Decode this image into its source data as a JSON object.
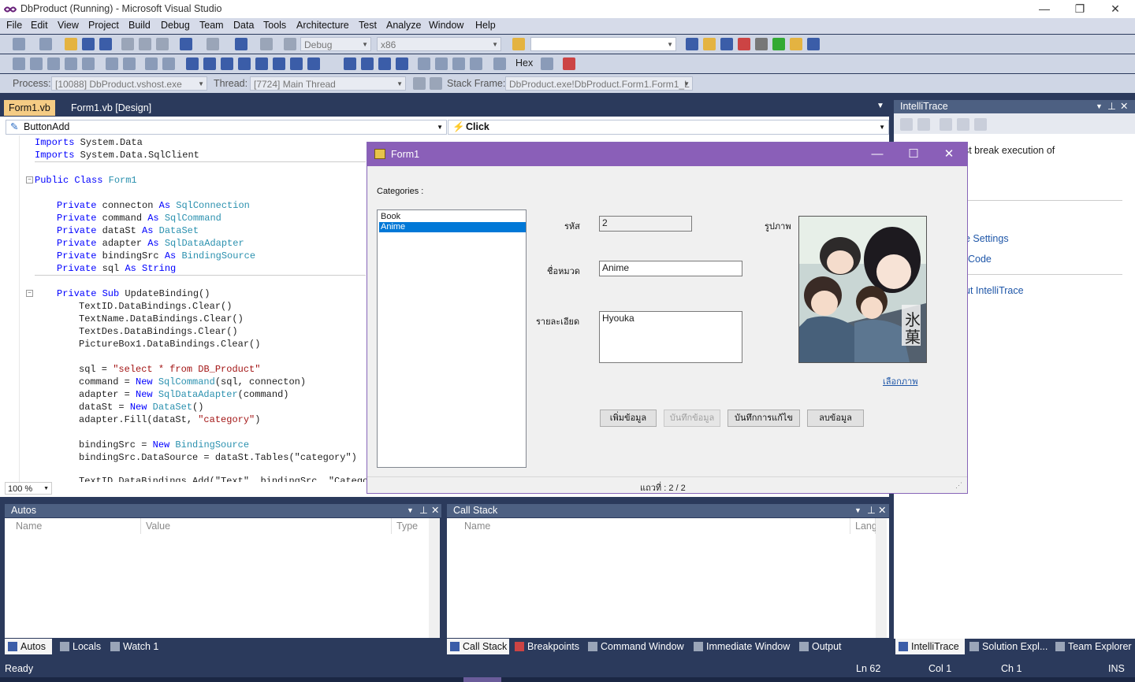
{
  "window": {
    "title": "DbProduct (Running) - Microsoft Visual Studio"
  },
  "menu": [
    "File",
    "Edit",
    "View",
    "Project",
    "Build",
    "Debug",
    "Team",
    "Data",
    "Tools",
    "Architecture",
    "Test",
    "Analyze",
    "Window",
    "Help"
  ],
  "toolbar": {
    "config": "Debug",
    "platform": "x86",
    "hex_label": "Hex",
    "process_label": "Process:",
    "process_value": "[10088] DbProduct.vshost.exe",
    "thread_label": "Thread:",
    "thread_value": "[7724] Main Thread",
    "stackframe_label": "Stack Frame:",
    "stackframe_value": "DbProduct.exe!DbProduct.Form1.Form1_L"
  },
  "tabs": [
    "Form1.vb",
    "Form1.vb [Design]"
  ],
  "nav": {
    "left": "ButtonAdd",
    "right": "Click"
  },
  "zoom": "100 %",
  "code": {
    "l1a": "Imports",
    "l1b": " System.Data",
    "l2a": "Imports",
    "l2b": " System.Data.SqlClient",
    "l3a": "Public Class",
    "l3b": " Form1",
    "p1a": "Private",
    "p1b": " connecton ",
    "p1c": "As",
    "p1d": " SqlConnection",
    "p2a": "Private",
    "p2b": " command ",
    "p2c": "As",
    "p2d": " SqlCommand",
    "p3a": "Private",
    "p3b": " dataSt ",
    "p3c": "As",
    "p3d": " DataSet",
    "p4a": "Private",
    "p4b": " adapter ",
    "p4c": "As",
    "p4d": " SqlDataAdapter",
    "p5a": "Private",
    "p5b": " bindingSrc ",
    "p5c": "As",
    "p5d": " BindingSource",
    "p6a": "Private",
    "p6b": " sql ",
    "p6c": "As",
    "p6d": " String",
    "s1a": "Private Sub",
    "s1b": " UpdateBinding()",
    "c1": "TextID.DataBindings.Clear()",
    "c2": "TextName.DataBindings.Clear()",
    "c3": "TextDes.DataBindings.Clear()",
    "c4": "PictureBox1.DataBindings.Clear()",
    "q1a": "sql = ",
    "q1b": "\"select * from DB_Product\"",
    "q2a": "command = ",
    "q2b": "New",
    "q2c": " SqlCommand",
    "q2d": "(sql, connecton)",
    "q3a": "adapter = ",
    "q3b": "New",
    "q3c": " SqlDataAdapter",
    "q3d": "(command)",
    "q4a": "dataSt = ",
    "q4b": "New",
    "q4c": " DataSet",
    "q4d": "()",
    "q5a": "adapter.Fill(dataSt, ",
    "q5b": "\"category\"",
    "q5c": ")",
    "b1a": "bindingSrc = ",
    "b1b": "New",
    "b1c": " BindingSource",
    "b2": "bindingSrc.DataSource = dataSt.Tables(\"category\")",
    "b3": "TextID.DataBindings.Add(\"Text\", bindingSrc, \"Categor"
  },
  "autos": {
    "title": "Autos",
    "cols": [
      "Name",
      "Value",
      "Type"
    ]
  },
  "callstack": {
    "title": "Call Stack",
    "cols": [
      "Name",
      "Lang"
    ]
  },
  "bottom_tabs_left": [
    "Autos",
    "Locals",
    "Watch 1"
  ],
  "bottom_tabs_mid": [
    "Call Stack",
    "Breakpoints",
    "Command Window",
    "Immediate Window",
    "Output"
  ],
  "bottom_tabs_right": [
    "IntelliTrace",
    "Solution Expl...",
    "Team Explorer"
  ],
  "intellitrace": {
    "title": "IntelliTrace",
    "text": "ce data, you must break execution of",
    "link1": "e Settings",
    "link2": "Code",
    "link3": "ut IntelliTrace"
  },
  "status": {
    "ready": "Ready",
    "ln": "Ln 62",
    "col": "Col 1",
    "ch": "Ch 1",
    "ins": "INS"
  },
  "form1": {
    "title": "Form1",
    "categories_label": "Categories :",
    "list": [
      "Book",
      "Anime"
    ],
    "selected_index": 1,
    "id_label": "รหัส",
    "id_value": "2",
    "name_label": "ชื่อหมวด",
    "name_value": "Anime",
    "desc_label": "รายละเอียด",
    "desc_value": "Hyouka",
    "pic_label": "รูปภาพ",
    "choose_pic": "เลือกภาพ",
    "btn_add": "เพิ่มข้อมูล",
    "btn_save": "บันทึกข้อมูล",
    "btn_update": "บันทึกการแก้ไข",
    "btn_delete": "ลบข้อมูล",
    "record": "แถวที่ : 2 / 2"
  },
  "colors": {
    "accent": "#8a5fb8",
    "selection": "#0078d7",
    "vs_dark": "#2b3a5c"
  }
}
